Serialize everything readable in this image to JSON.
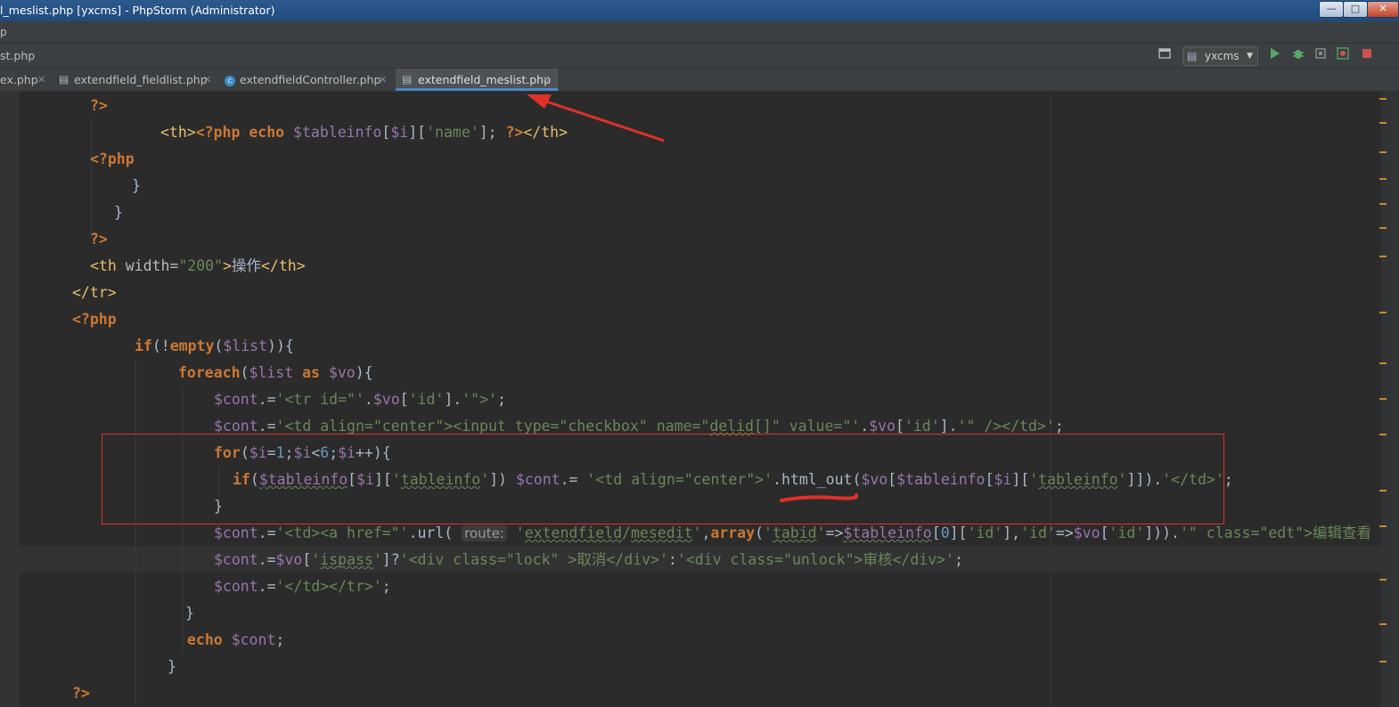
{
  "window": {
    "title": "l_meslist.php [yxcms] - PhpStorm (Administrator)",
    "controls": {
      "minimize": "—",
      "maximize": "□",
      "close": "✕"
    }
  },
  "menu": {
    "visible_fragment": "p"
  },
  "navbar": {
    "breadcrumb": "st.php",
    "run_config": "yxcms",
    "icons": [
      "layout-icon",
      "run-icon",
      "debug-icon",
      "coverage-icon",
      "profile-icon",
      "stop-icon"
    ]
  },
  "tabs": [
    {
      "label": "ex.php",
      "active": false
    },
    {
      "label": "extendfield_fieldlist.php",
      "active": false
    },
    {
      "label": "extendfieldController.php",
      "active": false
    },
    {
      "label": "extendfield_meslist.php",
      "active": true
    }
  ],
  "code": {
    "hint_route": "route:",
    "chinese": {
      "op": "操作",
      "cancel": "取消",
      "audit": "审核",
      "edit_view": "编辑查看"
    }
  },
  "colors": {
    "editor_bg": "#2b2b2b",
    "keyword": "#cc7832",
    "string": "#6a8759",
    "variable": "#9876aa",
    "tag": "#e8bf6a",
    "number": "#6897bb",
    "annotation_red": "#e0302a"
  }
}
